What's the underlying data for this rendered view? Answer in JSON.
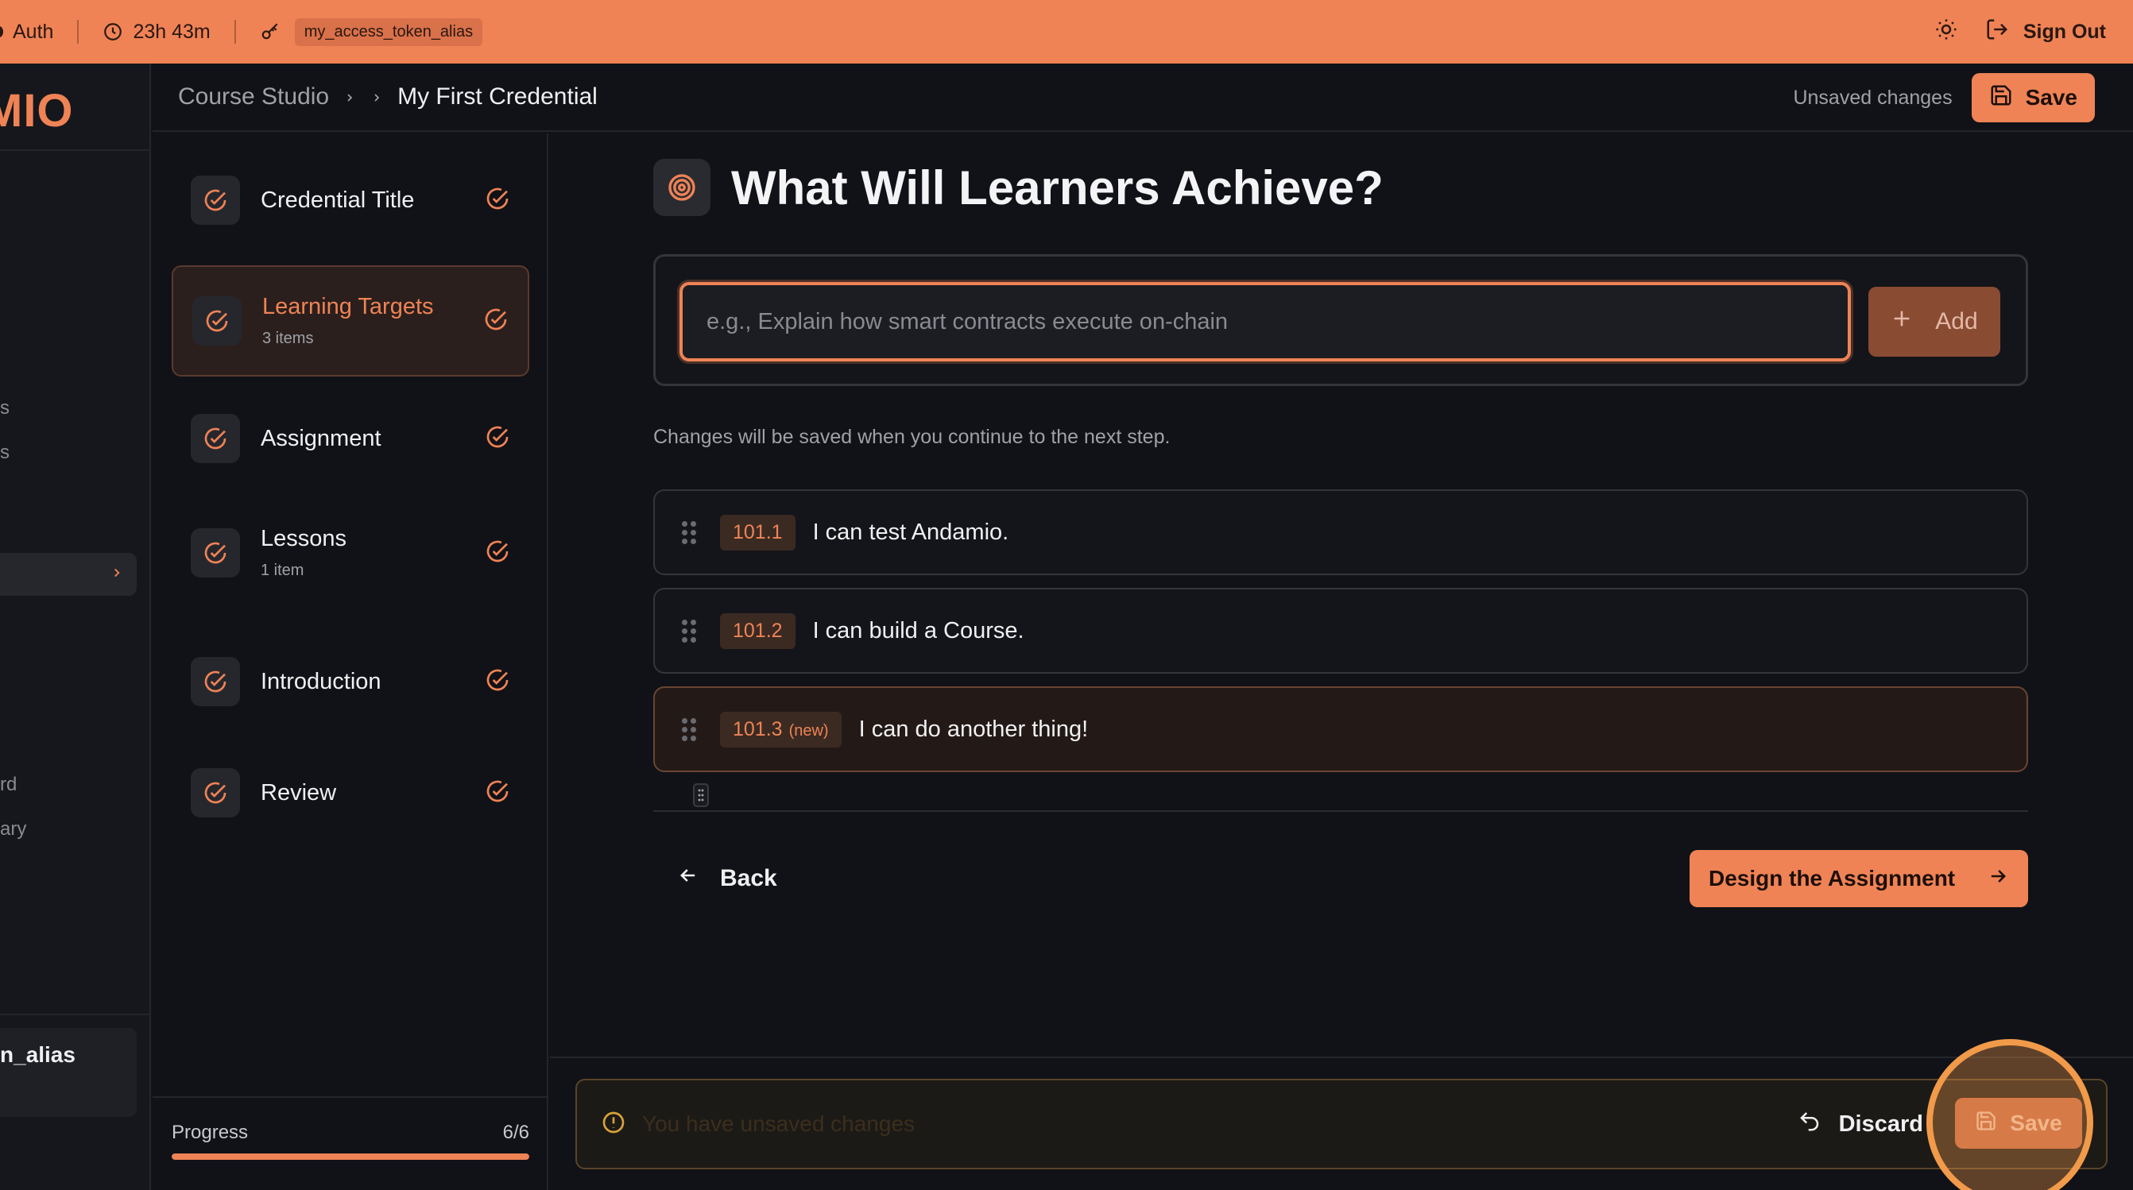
{
  "topbar": {
    "auth_label": "Auth",
    "timer": "23h 43m",
    "token_alias": "my_access_token_alias",
    "sign_out": "Sign Out"
  },
  "sidebar": {
    "logo": "MIO",
    "fragments": [
      "s",
      "s",
      "rd",
      "ary"
    ],
    "user_alias": "n_alias"
  },
  "breadcrumb": {
    "root": "Course Studio",
    "current": "My First Credential"
  },
  "header": {
    "status": "Unsaved changes",
    "save_label": "Save"
  },
  "steps": [
    {
      "title": "Credential Title",
      "sub": ""
    },
    {
      "title": "Learning Targets",
      "sub": "3 items",
      "active": true
    },
    {
      "title": "Assignment",
      "sub": ""
    },
    {
      "title": "Lessons",
      "sub": "1 item"
    },
    {
      "title": "Introduction",
      "sub": ""
    },
    {
      "title": "Review",
      "sub": ""
    }
  ],
  "progress": {
    "label": "Progress",
    "value_text": "6/6",
    "fraction": 1.0
  },
  "main": {
    "title": "What Will Learners Achieve?",
    "input_placeholder": "e.g., Explain how smart contracts execute on-chain",
    "add_label": "Add",
    "hint": "Changes will be saved when you continue to the next step.",
    "targets": [
      {
        "code": "101.1",
        "tag": "",
        "text": "I can test Andamio."
      },
      {
        "code": "101.2",
        "tag": "",
        "text": "I can build a Course."
      },
      {
        "code": "101.3",
        "tag": "(new)",
        "text": "I can do another thing!"
      }
    ],
    "back_label": "Back",
    "next_label": "Design the Assignment"
  },
  "unsaved_bar": {
    "message": "You have unsaved changes",
    "discard_label": "Discard",
    "save_label": "Save"
  },
  "colors": {
    "accent": "#ef8355",
    "background": "#111217"
  }
}
